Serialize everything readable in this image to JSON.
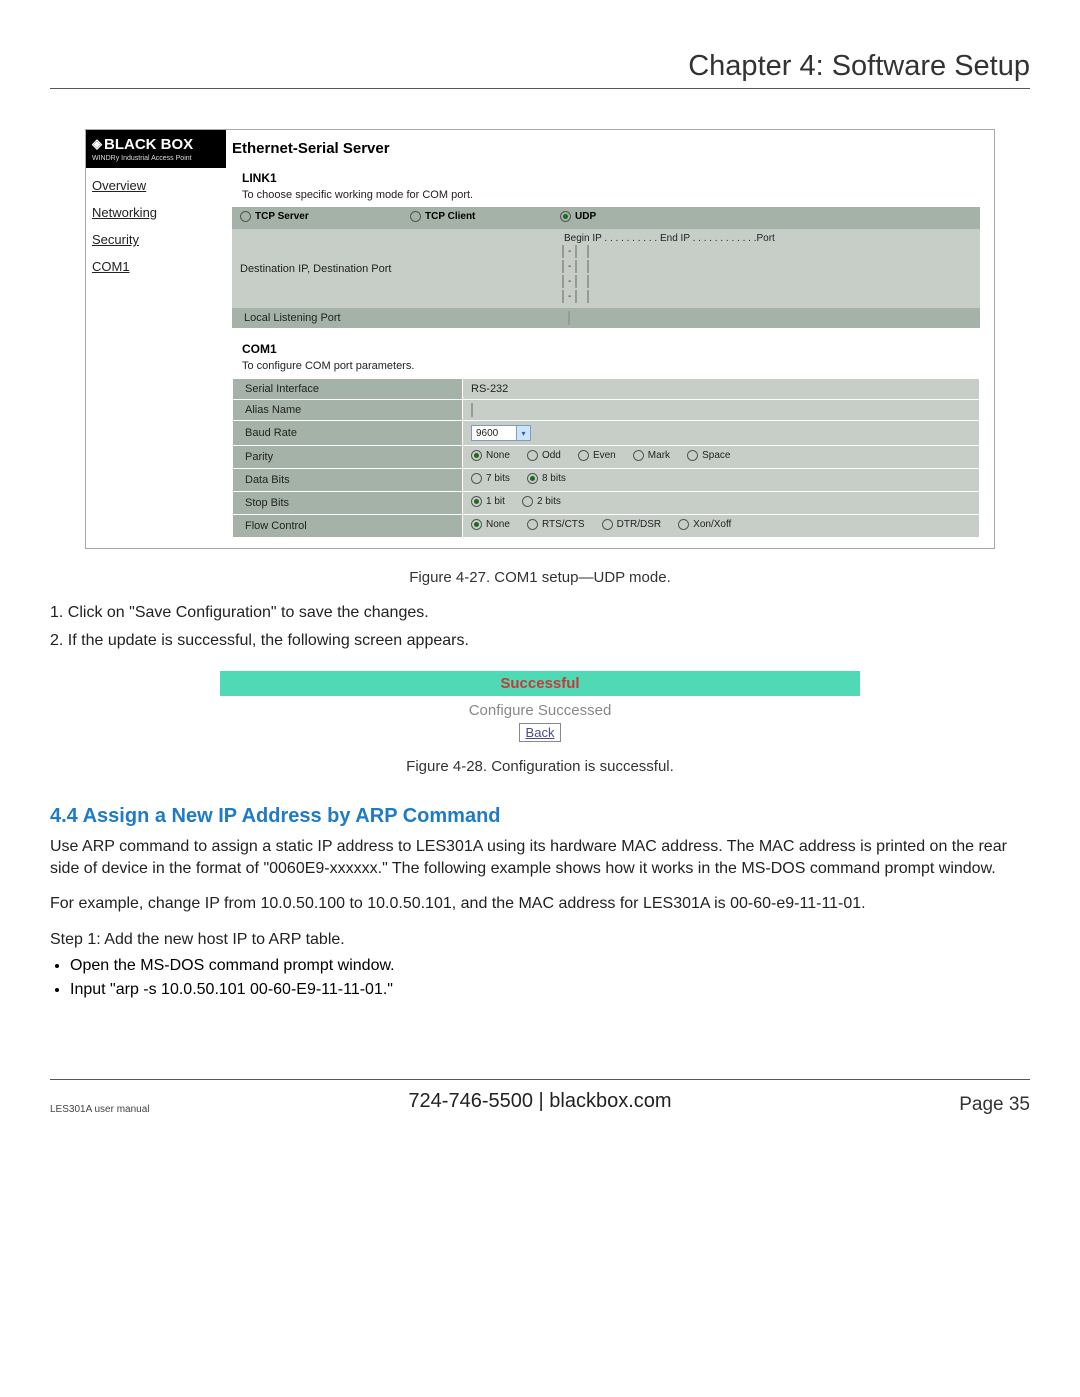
{
  "header": {
    "chapter": "Chapter 4: Software Setup"
  },
  "logo": {
    "brand": "BLACK BOX",
    "tag": "WINDRy Industrial Access Point"
  },
  "nav": {
    "overview": "Overview",
    "networking": "Networking",
    "security": "Security",
    "com1": "COM1"
  },
  "ess": {
    "title": "Ethernet-Serial Server"
  },
  "link1": {
    "head": "LINK1",
    "desc": "To choose specific working mode for COM port.",
    "mode_tcpserver": "TCP Server",
    "mode_tcpclient": "TCP Client",
    "mode_udp": "UDP",
    "ipcols": "Begin IP . . . . . . . . . . End IP . . . . . . . . . . . .Port",
    "destlabel": "Destination IP, Destination Port",
    "llp": "Local Listening Port"
  },
  "com1": {
    "head": "COM1",
    "desc": "To configure COM port parameters.",
    "rows": {
      "serial_if_l": "Serial Interface",
      "serial_if_v": "RS-232",
      "alias_l": "Alias Name",
      "baud_l": "Baud Rate",
      "baud_v": "9600",
      "parity_l": "Parity",
      "parity_none": "None",
      "parity_odd": "Odd",
      "parity_even": "Even",
      "parity_mark": "Mark",
      "parity_space": "Space",
      "databits_l": "Data Bits",
      "db7": "7 bits",
      "db8": "8 bits",
      "stopbits_l": "Stop Bits",
      "sb1": "1 bit",
      "sb2": "2 bits",
      "flow_l": "Flow Control",
      "fc_none": "None",
      "fc_rts": "RTS/CTS",
      "fc_dtr": "DTR/DSR",
      "fc_xon": "Xon/Xoff"
    }
  },
  "captions": {
    "fig27": "Figure 4-27. COM1 setup—UDP mode.",
    "fig28": "Figure 4-28. Configuration is successful."
  },
  "steps": {
    "s1": "1. Click on \"Save Configuration\" to save the changes.",
    "s2": "2. If the update is successful, the following screen appears."
  },
  "success": {
    "bar": "Successful",
    "body": "Configure Successed",
    "back": "Back"
  },
  "section44": {
    "head": "4.4 Assign a New IP Address by ARP Command",
    "p1": "Use ARP command to assign a static IP address to LES301A using its hardware MAC address. The MAC address is printed on the rear side of device in the format of \"0060E9-xxxxxx.\" The following example shows how it works in the MS-DOS command prompt window.",
    "p2": "For example, change IP from 10.0.50.100 to 10.0.50.101, and the MAC address for LES301A is 00-60-e9-11-11-01.",
    "step1": "Step 1: Add the new host IP to ARP table.",
    "b1": "Open the MS-DOS command prompt window.",
    "b2": "Input \"arp -s 10.0.50.101 00-60-E9-11-11-01.\""
  },
  "footer": {
    "left": "LES301A user manual",
    "center": "724-746-5500   |   blackbox.com",
    "right": "Page 35"
  }
}
